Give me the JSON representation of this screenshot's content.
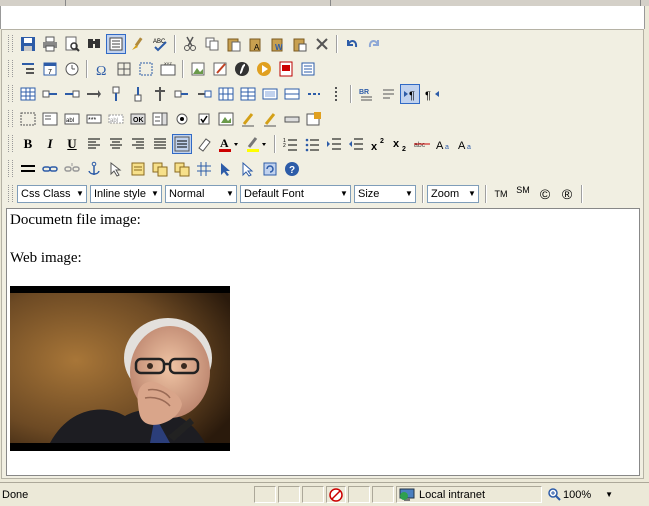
{
  "toolbar": {
    "row1": [
      "save-icon",
      "print-icon",
      "preview-icon",
      "find-icon",
      "replace-icon",
      "format-painter-icon",
      "spellcheck-icon",
      "cut-icon",
      "copy-icon",
      "paste-icon",
      "paste-text-icon",
      "paste-word-icon",
      "paste-html-icon",
      "delete-icon",
      "undo-icon",
      "redo-icon"
    ],
    "row2": [
      "paragraph-icon",
      "date-icon",
      "time-icon",
      "special-char-icon",
      "table-icon",
      "frame-icon",
      "layer-icon",
      "image-icon",
      "image-edit-icon",
      "flash-icon",
      "media-icon",
      "pdf-icon",
      "document-icon"
    ],
    "row3": [
      "insert-table-icon",
      "col-left-icon",
      "col-right-icon",
      "col-delete-icon",
      "row-above-icon",
      "row-below-icon",
      "row-delete-icon",
      "merge-icon",
      "split-icon",
      "cell-props-icon",
      "table-props-icon",
      "border-icon",
      "spacer-icon",
      "pipe-icon",
      "page-break-icon",
      "format-text-icon",
      "ltr-icon",
      "rtl-icon"
    ],
    "row4": [
      "form-icon",
      "textbox-icon",
      "textarea-icon",
      "password-icon",
      "hidden-icon",
      "button-icon",
      "listbox-icon",
      "radio-icon",
      "checkbox-icon",
      "image-button-icon",
      "pencil-icon",
      "pencil2-icon",
      "field-icon",
      "form-props-icon"
    ],
    "row5": {
      "bold": "B",
      "italic": "I",
      "underline": "U",
      "icons": [
        "align-left-icon",
        "align-center-icon",
        "align-right-icon",
        "justify-icon",
        "justify-box-icon",
        "eraser-icon",
        "font-color-icon",
        "highlight-icon",
        "ordered-list-icon",
        "unordered-list-icon",
        "indent-icon",
        "outdent-icon",
        "superscript-icon",
        "subscript-icon",
        "strike-icon",
        "text-case-icon",
        "text-case2-icon"
      ]
    },
    "row6": [
      "hr-icon",
      "link-icon",
      "unlink-icon",
      "anchor-icon",
      "help-pointer-icon",
      "template-icon",
      "snippet-icon",
      "snippet2-icon",
      "grid-icon",
      "pointer-icon",
      "select-icon",
      "refresh-icon",
      "help-icon"
    ],
    "row7": {
      "css_class": "Css Class",
      "inline_style": "Inline style",
      "paragraph": "Normal",
      "font": "Default Font",
      "size": "Size",
      "zoom": "Zoom",
      "tm": "TM",
      "sm": "SM",
      "copyright": "©",
      "registered": "®"
    }
  },
  "content": {
    "line1": "Documetn file image:",
    "line2": "Web image:"
  },
  "status": {
    "text": "Done",
    "zone": "Local intranet",
    "zoom": "100%"
  }
}
